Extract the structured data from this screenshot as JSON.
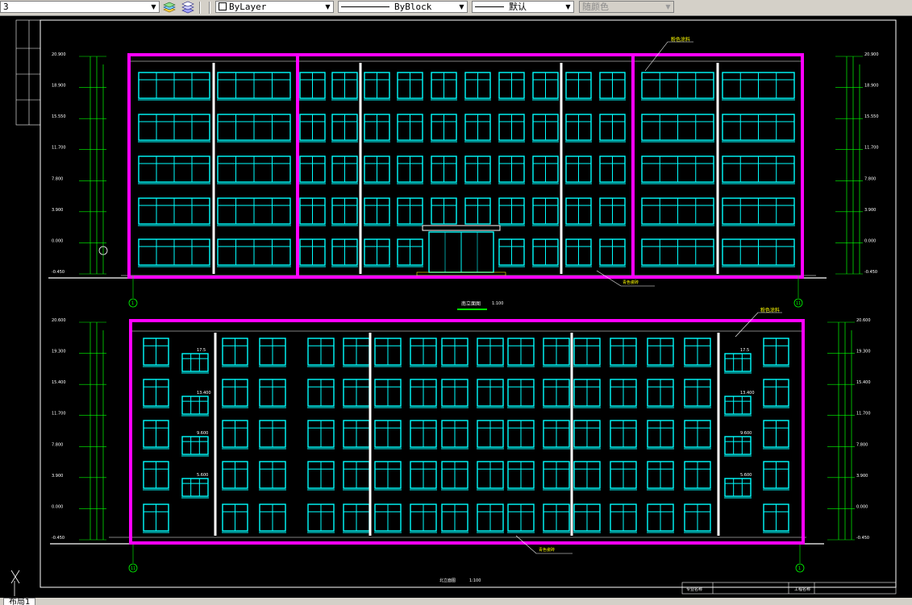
{
  "toolbar": {
    "layer_value": "3",
    "color_value": "ByLayer",
    "linetype_value": "ByBlock",
    "lineweight_value": "默认",
    "plotstyle_value": "随颜色"
  },
  "tabs": {
    "layout_tab": "布局1"
  },
  "drawing": {
    "title_front": "南立面图",
    "title_back": "北立面图",
    "scale": "1:100",
    "leader_top1": "粉色涂料",
    "leader_top2": "粉色涂料",
    "leader_bottom1": "青色瓷砖",
    "leader_bottom2": "青色瓷砖",
    "axis_start": "1",
    "axis_end": "11",
    "elevations_upper": [
      "20.900",
      "18.900",
      "15.550",
      "11.700",
      "7.800",
      "3.900",
      "0.000",
      "-0.450"
    ],
    "elevations_lower": [
      "20.600",
      "19.300",
      "15.400",
      "11.700",
      "7.800",
      "3.900",
      "0.000",
      "-0.450"
    ],
    "landing_labels": [
      "17.5",
      "13.400",
      "9.600",
      "5.600"
    ],
    "title_block": {
      "cell1": "专业名称",
      "cell2": "工程名称"
    }
  },
  "colors": {
    "cyan": "#00ffff",
    "magenta": "#ff00ff",
    "green": "#00ff00",
    "background": "#000000"
  }
}
